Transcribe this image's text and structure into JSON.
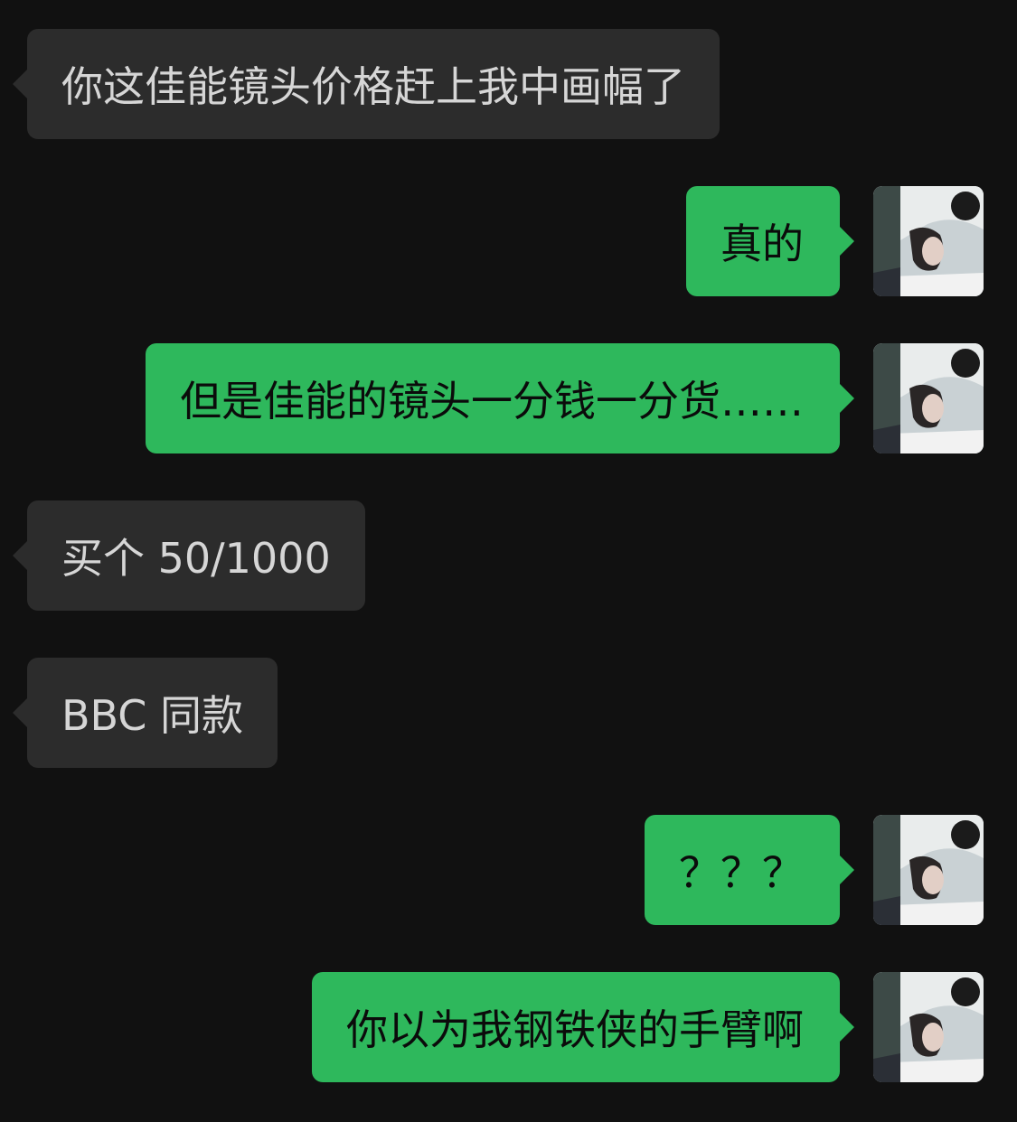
{
  "messages": [
    {
      "direction": "incoming",
      "text": "你这佳能镜头价格赶上我中画幅了"
    },
    {
      "direction": "outgoing",
      "text": "真的"
    },
    {
      "direction": "outgoing",
      "text": "但是佳能的镜头一分钱一分货……"
    },
    {
      "direction": "incoming",
      "text": "买个 50/1000"
    },
    {
      "direction": "incoming",
      "text": "BBC 同款"
    },
    {
      "direction": "outgoing",
      "text": "？？？"
    },
    {
      "direction": "outgoing",
      "text": "你以为我钢铁侠的手臂啊"
    }
  ],
  "colors": {
    "background": "#111111",
    "incoming_bubble": "#2c2c2c",
    "outgoing_bubble": "#2eb85c"
  }
}
